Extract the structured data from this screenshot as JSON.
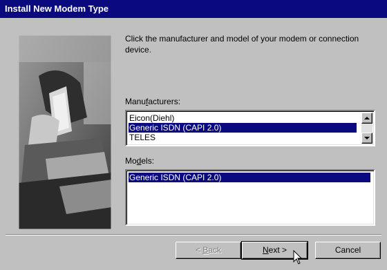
{
  "window": {
    "title": "Install New Modem Type"
  },
  "instructions": "Click the manufacturer and model of your modem or connection device.",
  "manufacturers": {
    "label_pre": "Manu",
    "label_u": "f",
    "label_post": "acturers:",
    "items": [
      "Eicon(Diehl)",
      "Generic ISDN (CAPI 2.0)",
      "TELES"
    ],
    "selected_index": 1
  },
  "models": {
    "label_pre": "Mo",
    "label_u": "d",
    "label_post": "els:",
    "items": [
      "Generic ISDN (CAPI 2.0)"
    ],
    "selected_index": 0
  },
  "buttons": {
    "back_pre": "< ",
    "back_u": "B",
    "back_post": "ack",
    "next_u": "N",
    "next_post": "ext >",
    "cancel": "Cancel"
  },
  "colors": {
    "title_bar": "#0a0a7e",
    "selection": "#0a0a7e",
    "face": "#c0c0c0"
  },
  "icons": {
    "photo": "person-using-phone-photo",
    "cursor": "arrow-cursor-icon"
  }
}
